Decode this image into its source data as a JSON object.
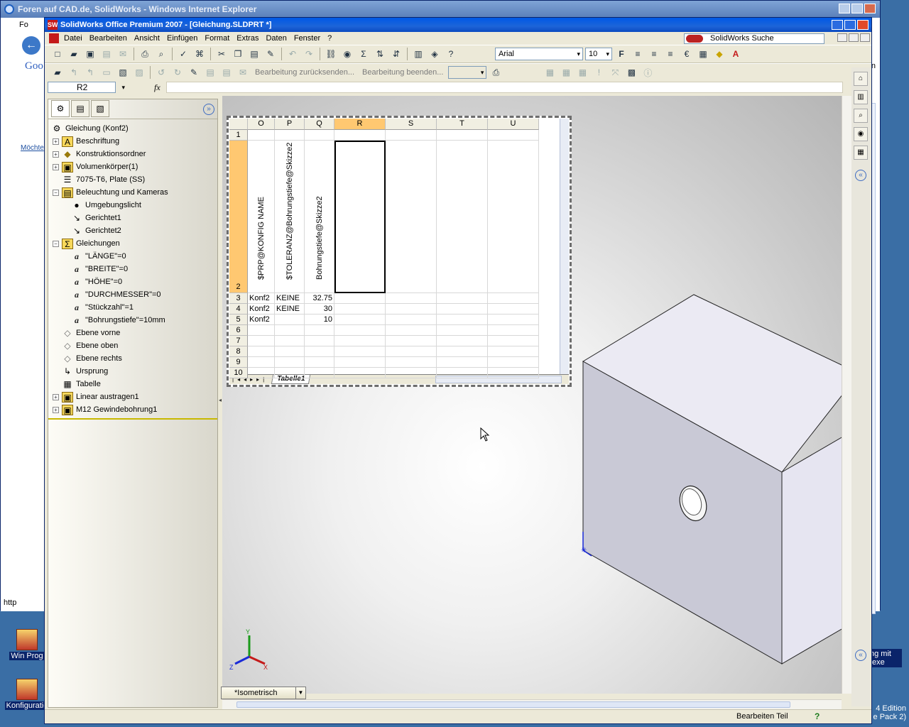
{
  "browser": {
    "title": "Foren auf CAD.de, SolidWorks - Windows Internet Explorer",
    "left_link": "Möchte",
    "address_prefix": "http",
    "right_menu": "gen",
    "side_goo": "Goo",
    "tab_partial": "Fo"
  },
  "desktop": {
    "icon1_label": "Win Prog",
    "icon2_label": "Konfiguratio",
    "right_label1": "ng mit .exe",
    "right_label2": "4 Edition",
    "right_label3": "e Pack 2)"
  },
  "sw": {
    "title": "SolidWorks Office Premium 2007 - [Gleichung.SLDPRT *]",
    "menu": [
      "Datei",
      "Bearbeiten",
      "Ansicht",
      "Einfügen",
      "Format",
      "Extras",
      "Daten",
      "Fenster",
      "?"
    ],
    "search_placeholder": "SolidWorks Suche",
    "font_name": "Arial",
    "font_size": "10",
    "edit_resend": "Bearbeitung zurücksenden...",
    "edit_end": "Bearbeitung beenden...",
    "name_box": "R2",
    "fx": "fx"
  },
  "tree": {
    "root": "Gleichung (Konf2)",
    "items": [
      {
        "label": "Beschriftung",
        "exp": "+",
        "icon": "A",
        "level": 0
      },
      {
        "label": "Konstruktionsordner",
        "exp": "+",
        "icon": "◆",
        "level": 0
      },
      {
        "label": "Volumenkörper(1)",
        "exp": "+",
        "icon": "▣",
        "level": 0
      },
      {
        "label": "7075-T6, Plate (SS)",
        "exp": "",
        "icon": "☰",
        "level": 0
      },
      {
        "label": "Beleuchtung und Kameras",
        "exp": "−",
        "icon": "▤",
        "level": 0
      },
      {
        "label": "Umgebungslicht",
        "exp": "",
        "icon": "●",
        "level": 1
      },
      {
        "label": "Gerichtet1",
        "exp": "",
        "icon": "↘",
        "level": 1
      },
      {
        "label": "Gerichtet2",
        "exp": "",
        "icon": "↘",
        "level": 1
      },
      {
        "label": "Gleichungen",
        "exp": "−",
        "icon": "Σ",
        "level": 0
      },
      {
        "label": "\"LÄNGE\"=0",
        "exp": "",
        "icon": "a",
        "level": 1
      },
      {
        "label": "\"BREITE\"=0",
        "exp": "",
        "icon": "a",
        "level": 1
      },
      {
        "label": "\"HÖHE\"=0",
        "exp": "",
        "icon": "a",
        "level": 1
      },
      {
        "label": "\"DURCHMESSER\"=0",
        "exp": "",
        "icon": "a",
        "level": 1
      },
      {
        "label": "\"Stückzahl\"=1",
        "exp": "",
        "icon": "a",
        "level": 1
      },
      {
        "label": "\"Bohrungstiefe\"=10mm",
        "exp": "",
        "icon": "a",
        "level": 1
      },
      {
        "label": "Ebene vorne",
        "exp": "",
        "icon": "◇",
        "level": 0
      },
      {
        "label": "Ebene oben",
        "exp": "",
        "icon": "◇",
        "level": 0
      },
      {
        "label": "Ebene rechts",
        "exp": "",
        "icon": "◇",
        "level": 0
      },
      {
        "label": "Ursprung",
        "exp": "",
        "icon": "↳",
        "level": 0
      },
      {
        "label": "Tabelle",
        "exp": "",
        "icon": "▦",
        "level": 0
      },
      {
        "label": "Linear austragen1",
        "exp": "+",
        "icon": "▣",
        "level": 0
      },
      {
        "label": "M12 Gewindebohrung1",
        "exp": "+",
        "icon": "▣",
        "level": 0
      }
    ]
  },
  "sheet": {
    "columns": [
      "O",
      "P",
      "Q",
      "R",
      "S",
      "T",
      "U"
    ],
    "selected_column": "R",
    "header_row": [
      "$PRP@KONFIG NAME",
      "$TOLERANZ@Bohrungstiefe@Skizze2",
      "Bohrungstiefe@Skizze2"
    ],
    "rows": [
      {
        "num": "1",
        "cells": [
          "",
          "",
          ""
        ]
      },
      {
        "num": "2",
        "cells": [
          "",
          "",
          ""
        ]
      },
      {
        "num": "3",
        "cells": [
          "Konf2",
          "KEINE",
          "32.75"
        ]
      },
      {
        "num": "4",
        "cells": [
          "Konf2",
          "KEINE",
          "30"
        ]
      },
      {
        "num": "5",
        "cells": [
          "Konf2",
          "",
          "10"
        ]
      },
      {
        "num": "6",
        "cells": [
          "",
          "",
          ""
        ]
      },
      {
        "num": "7",
        "cells": [
          "",
          "",
          ""
        ]
      },
      {
        "num": "8",
        "cells": [
          "",
          "",
          ""
        ]
      },
      {
        "num": "9",
        "cells": [
          "",
          "",
          ""
        ]
      },
      {
        "num": "10",
        "cells": [
          "",
          "",
          ""
        ]
      }
    ],
    "tab_name": "Tabelle1"
  },
  "view": {
    "orientation": "*Isometrisch"
  },
  "status": {
    "text": "Bearbeiten Teil",
    "help": "?"
  },
  "colors": {
    "title_blue": "#0058e6",
    "selection_orange": "#ffc871"
  }
}
